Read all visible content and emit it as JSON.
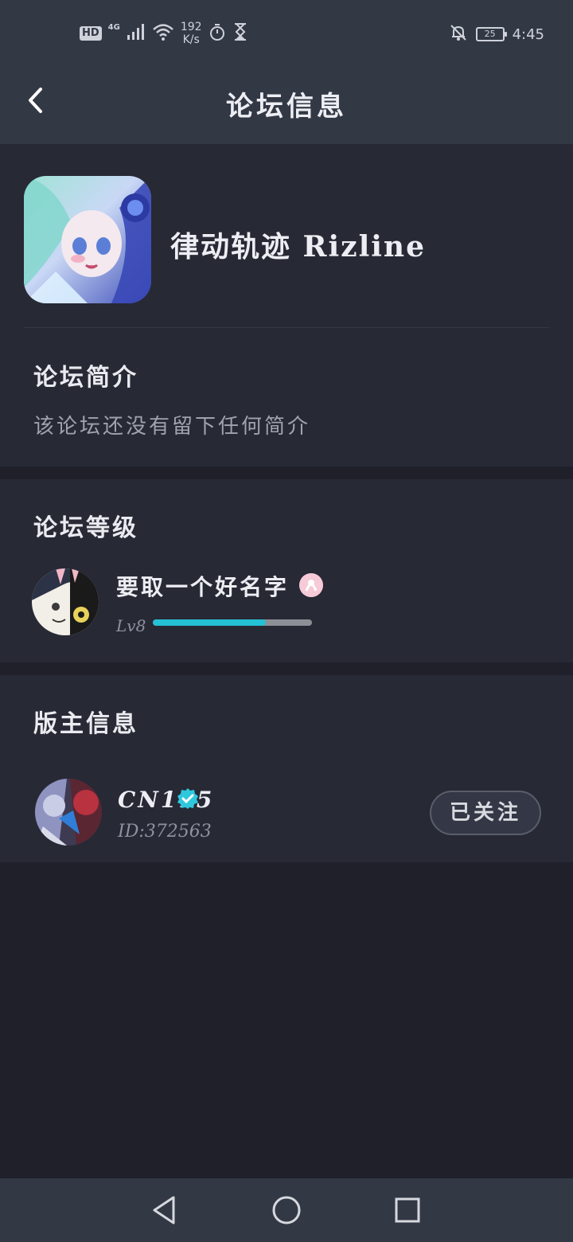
{
  "status_bar": {
    "hd": "HD",
    "network": "4G",
    "speed_value": "192",
    "speed_unit": "K/s",
    "battery": "25",
    "time": "4:45",
    "icons": [
      "signal-icon",
      "wifi-icon",
      "timer-icon",
      "hourglass-icon",
      "bell-off-icon",
      "battery-icon"
    ]
  },
  "header": {
    "title": "论坛信息",
    "back_icon": "chevron-left-icon"
  },
  "forum": {
    "name": "律动轨迹 Rizline",
    "intro_title": "论坛简介",
    "intro_text": "该论坛还没有留下任何简介"
  },
  "level": {
    "section_title": "论坛等级",
    "username": "要取一个好名字",
    "level_label": "Lv8",
    "progress": 0.71,
    "accent": "#25c1d4"
  },
  "moderator": {
    "section_title": "版主信息",
    "name": "CN115",
    "id_text": "ID:372563",
    "follow_label": "已关注",
    "verified_color": "#2fc7dc"
  },
  "nav": {
    "icons": [
      "back-triangle-icon",
      "home-circle-icon",
      "recents-square-icon"
    ]
  }
}
